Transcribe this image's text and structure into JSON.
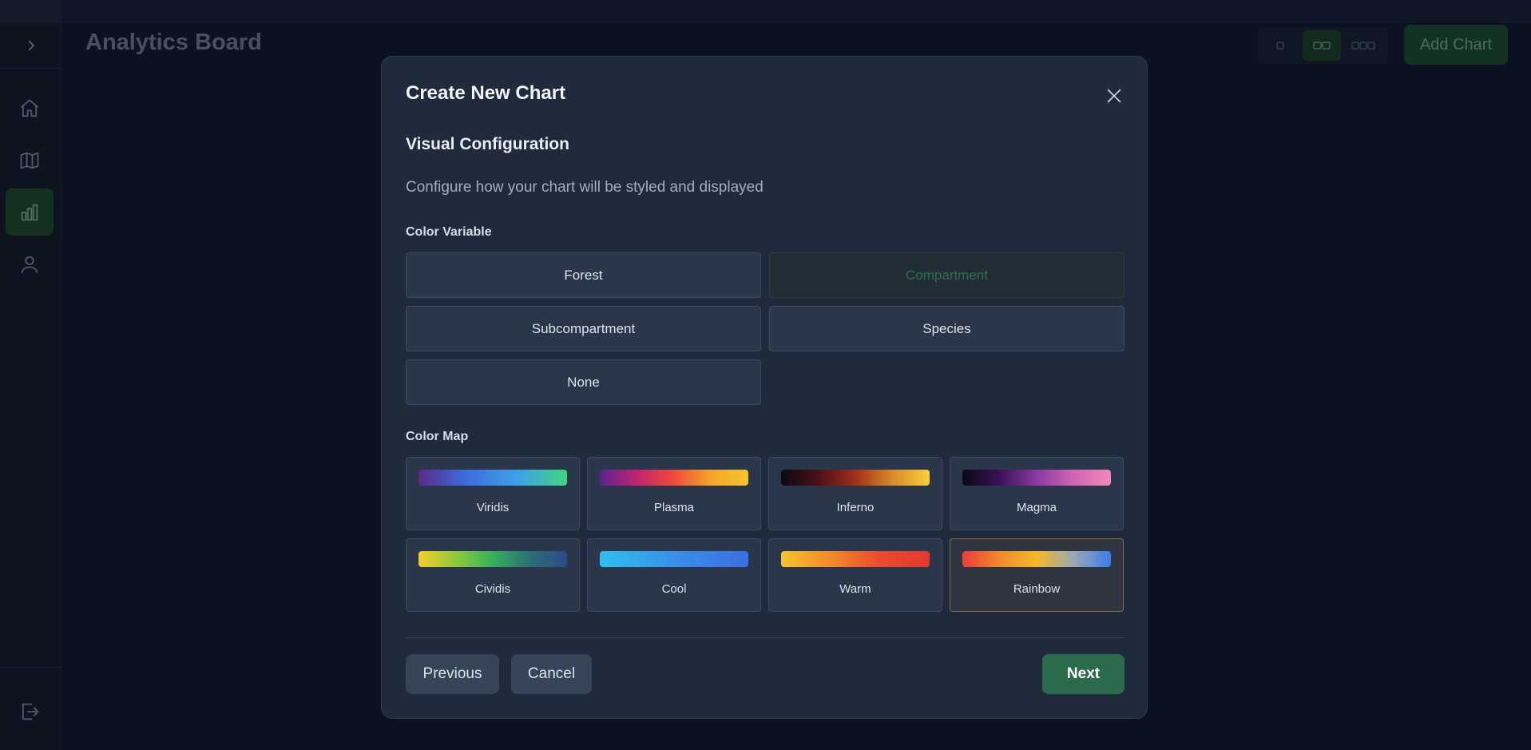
{
  "header": {
    "title": "Analytics Board",
    "add_chart_label": "Add Chart"
  },
  "layout_options": [
    "one-column-icon",
    "two-column-icon",
    "three-column-icon"
  ],
  "sidebar": {
    "items": [
      "home-icon",
      "map-icon",
      "chart-icon",
      "user-icon"
    ],
    "active": "chart-icon"
  },
  "modal": {
    "title": "Create New Chart",
    "section_title": "Visual Configuration",
    "section_desc": "Configure how your chart will be styled and displayed",
    "color_variable": {
      "label": "Color Variable",
      "options": [
        "Forest",
        "Compartment",
        "Subcompartment",
        "Species",
        "None"
      ],
      "selected": "Compartment"
    },
    "color_map": {
      "label": "Color Map",
      "options": [
        {
          "name": "Viridis",
          "colors": [
            "#5b2a86",
            "#3b6fe0",
            "#3fa0e8",
            "#3fd67f"
          ]
        },
        {
          "name": "Plasma",
          "colors": [
            "#5b2390",
            "#c0246e",
            "#ef4b3a",
            "#f4a72a",
            "#f6c42d"
          ]
        },
        {
          "name": "Inferno",
          "colors": [
            "#0a0a14",
            "#4a1018",
            "#a0301a",
            "#d88a2a",
            "#f7d13a"
          ]
        },
        {
          "name": "Magma",
          "colors": [
            "#0a0a14",
            "#3a1158",
            "#8a3aa0",
            "#d066b5",
            "#f08ab8"
          ]
        },
        {
          "name": "Cividis",
          "colors": [
            "#f4cd2a",
            "#8ecb3a",
            "#35b15a",
            "#2b6e73",
            "#2c4a8a"
          ]
        },
        {
          "name": "Cool",
          "colors": [
            "#2ec0ee",
            "#3a8fe8",
            "#3b6fe0"
          ]
        },
        {
          "name": "Warm",
          "colors": [
            "#f6c42d",
            "#f28a2a",
            "#ea4a2e",
            "#e03a30"
          ]
        },
        {
          "name": "Rainbow",
          "colors": [
            "#ea3d3d",
            "#f08a2a",
            "#f5b82a",
            "#9aa9b4",
            "#3b7be8"
          ]
        }
      ],
      "selected": "Rainbow"
    },
    "buttons": {
      "previous": "Previous",
      "cancel": "Cancel",
      "next": "Next"
    }
  }
}
